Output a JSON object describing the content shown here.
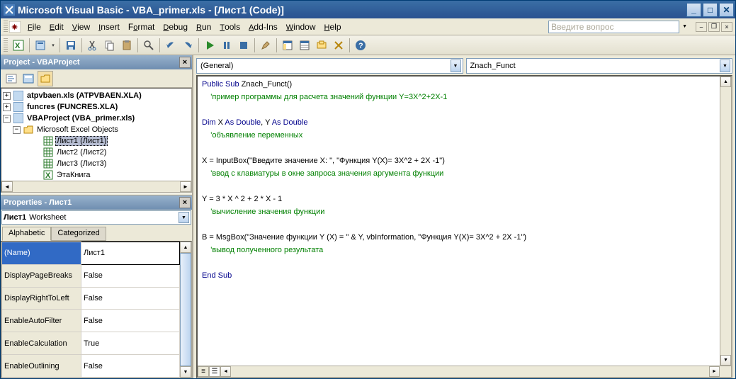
{
  "title": "Microsoft Visual Basic - VBA_primer.xls - [Лист1 (Code)]",
  "menu": {
    "file": "File",
    "edit": "Edit",
    "view": "View",
    "insert": "Insert",
    "format": "Format",
    "debug": "Debug",
    "run": "Run",
    "tools": "Tools",
    "addins": "Add-Ins",
    "window": "Window",
    "help": "Help"
  },
  "askbox_placeholder": "Введите вопрос",
  "project": {
    "title": "Project - VBAProject",
    "nodes": {
      "n1": "atpvbaen.xls (ATPVBAEN.XLA)",
      "n2": "funcres (FUNCRES.XLA)",
      "n3": "VBAProject (VBA_primer.xls)",
      "n4": "Microsoft Excel Objects",
      "n5": "Лист1 (Лист1)",
      "n6": "Лист2 (Лист2)",
      "n7": "Лист3 (Лист3)",
      "n8": "ЭтаКнига"
    }
  },
  "properties": {
    "title": "Properties - Лист1",
    "object_name": "Лист1",
    "object_type": "Worksheet",
    "tab_alpha": "Alphabetic",
    "tab_cat": "Categorized",
    "rows": [
      {
        "k": "(Name)",
        "v": "Лист1"
      },
      {
        "k": "DisplayPageBreaks",
        "v": "False"
      },
      {
        "k": "DisplayRightToLeft",
        "v": "False"
      },
      {
        "k": "EnableAutoFilter",
        "v": "False"
      },
      {
        "k": "EnableCalculation",
        "v": "True"
      },
      {
        "k": "EnableOutlining",
        "v": "False"
      }
    ]
  },
  "code": {
    "object_dd": "(General)",
    "proc_dd": "Znach_Funct",
    "l01a": "Public Sub",
    "l01b": " Znach_Funct()",
    "l02": "    'пример программы для расчета значений функции Y=3X^2+2X-1",
    "l04a": "Dim",
    "l04b": " X ",
    "l04c": "As Double",
    "l04d": ", Y ",
    "l04e": "As Double",
    "l05": "    'объявление переменных",
    "l07": "X = InputBox(\"Введите значение X: \", \"Функция Y(X)= 3X^2 + 2X -1\")",
    "l08": "    'ввод с клавиатуры в окне запроса значения аргумента функции",
    "l10": "Y = 3 * X ^ 2 + 2 * X - 1",
    "l11": "    'вычисление значения функции",
    "l13": "B = MsgBox(\"Значение функции Y (X) = \" & Y, vbInformation, \"Функция Y(X)= 3X^2 + 2X -1\")",
    "l14": "    'вывод полученного результата",
    "l16": "End Sub"
  }
}
